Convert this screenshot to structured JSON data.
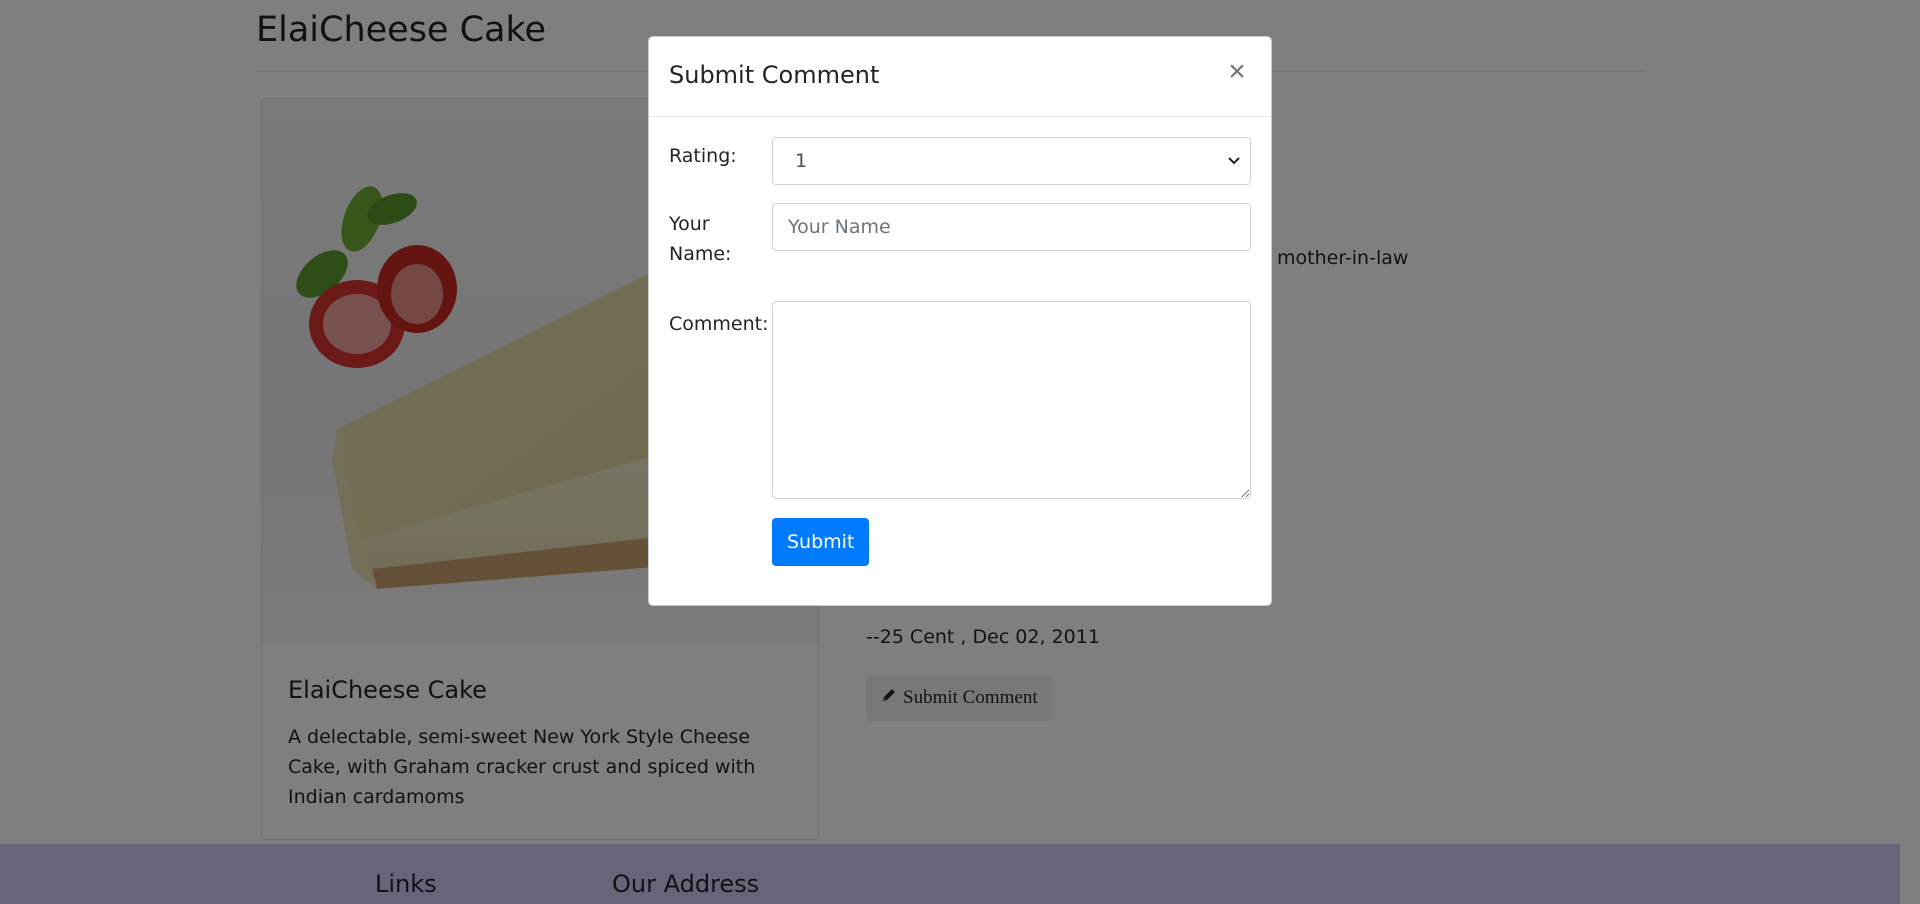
{
  "page": {
    "title": "ElaiCheese Cake"
  },
  "card": {
    "title": "ElaiCheese Cake",
    "description": "A delectable, semi-sweet New York Style Cheese Cake, with Graham cracker crust and spiced with Indian cardamoms"
  },
  "comments": {
    "visible_fragment": "mother-in-law",
    "author_line": "--25 Cent , Dec 02, 2011",
    "submit_comment_label": "Submit Comment",
    "submit_comment_icon": "pencil-icon"
  },
  "footer": {
    "links_heading": "Links",
    "address_heading": "Our Address"
  },
  "modal": {
    "title": "Submit Comment",
    "close_label": "×",
    "rating_label": "Rating:",
    "rating_value": "1",
    "name_label": "Your Name:",
    "name_placeholder": "Your Name",
    "comment_label": "Comment:",
    "submit_label": "Submit"
  },
  "colors": {
    "primary": "#007bff",
    "footer_bg": "#d7c6f3",
    "backdrop": "rgba(0,0,0,0.5)"
  }
}
